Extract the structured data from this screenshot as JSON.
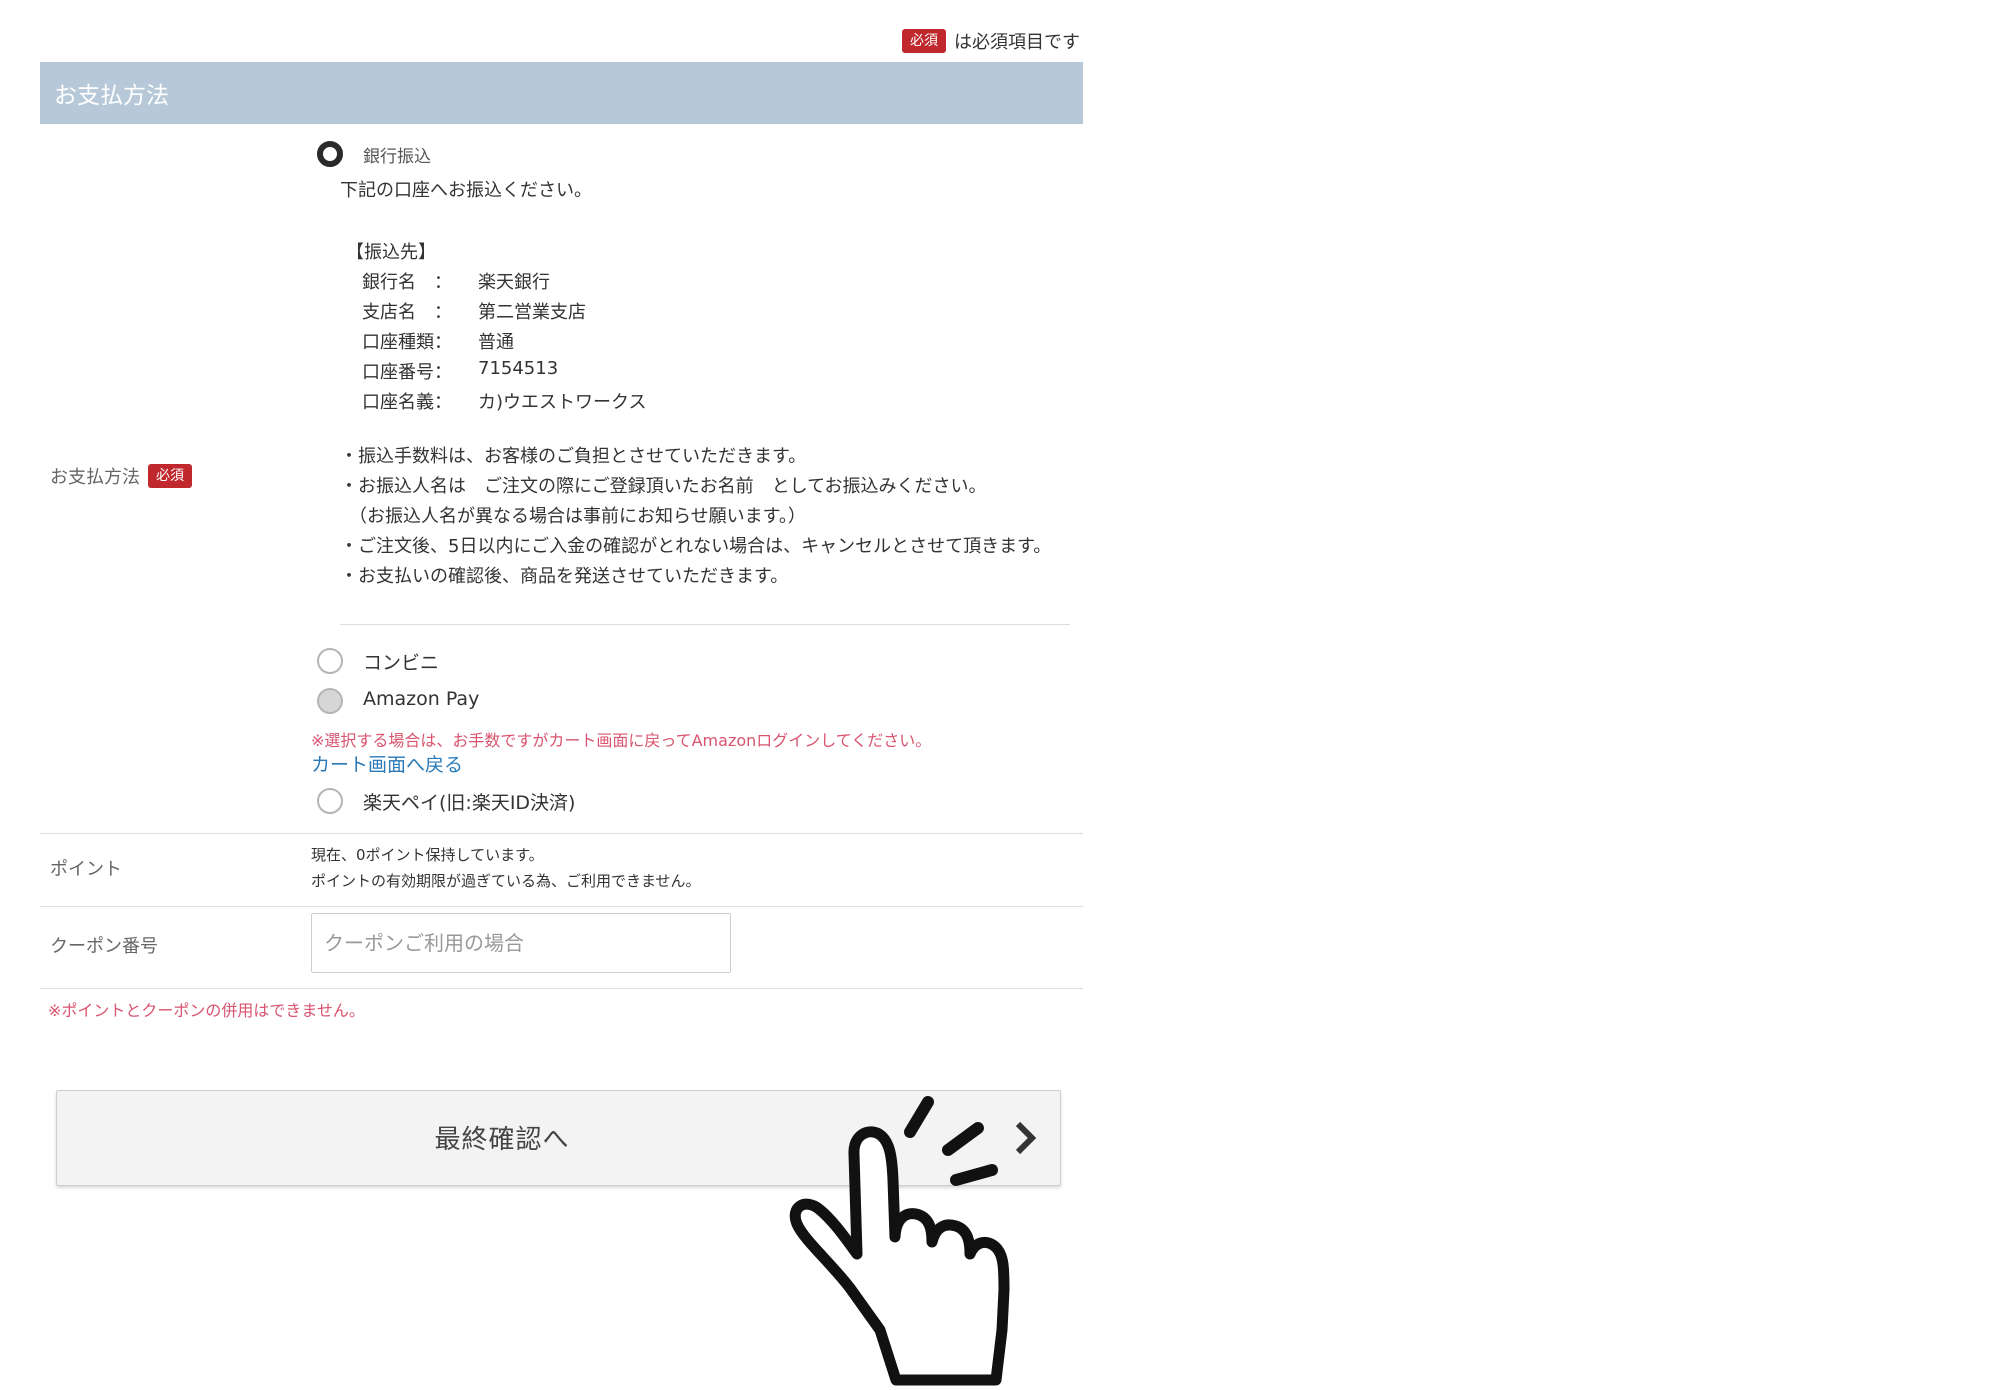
{
  "required_note": {
    "badge": "必須",
    "text": "は必須項目です"
  },
  "section": {
    "title": "お支払方法"
  },
  "payment": {
    "label": "お支払方法",
    "badge": "必須",
    "options": [
      {
        "label": "銀行振込",
        "state": "checked"
      },
      {
        "label": "コンビニ",
        "state": "unchecked"
      },
      {
        "label": "Amazon Pay",
        "state": "disabled"
      },
      {
        "label": "楽天ペイ(旧:楽天ID決済)",
        "state": "unchecked"
      }
    ],
    "bank": {
      "intro": "下記の口座へお振込ください。",
      "heading": "【振込先】",
      "rows": [
        {
          "key": "銀行名　：",
          "value": "楽天銀行"
        },
        {
          "key": "支店名　：",
          "value": "第二営業支店"
        },
        {
          "key": "口座種類：",
          "value": "普通"
        },
        {
          "key": "口座番号：",
          "value": "7154513"
        },
        {
          "key": "口座名義：",
          "value": "カ)ウエストワークス"
        }
      ],
      "notes": [
        "・振込手数料は、お客様のご負担とさせていただきます。",
        "・お振込人名は　ご注文の際にご登録頂いたお名前　としてお振込みください。",
        "　（お振込人名が異なる場合は事前にお知らせ願います。）",
        "・ご注文後、5日以内にご入金の確認がとれない場合は、キャンセルとさせて頂きます。",
        "・お支払いの確認後、商品を発送させていただきます。"
      ]
    },
    "amazon_warning": "※選択する場合は、お手数ですがカート画面に戻ってAmazonログインしてください。",
    "cart_link": "カート画面へ戻る"
  },
  "points": {
    "label": "ポイント",
    "line1": "現在、0ポイント保持しています。",
    "line2": "ポイントの有効期限が過ぎている為、ご利用できません。"
  },
  "coupon": {
    "label": "クーポン番号",
    "value": "",
    "placeholder": "クーポンご利用の場合"
  },
  "combo_warning": "※ポイントとクーポンの併用はできません。",
  "final_button": {
    "label": "最終確認へ"
  },
  "colors": {
    "header_bg": "#b7c9d8",
    "badge_red": "#c0282d",
    "warning_pink": "#d9546e",
    "link_blue": "#2a7ab8"
  },
  "icons": [
    "chevron-right-icon",
    "tap-hand-icon",
    "radio-checked-icon",
    "radio-empty-icon"
  ]
}
